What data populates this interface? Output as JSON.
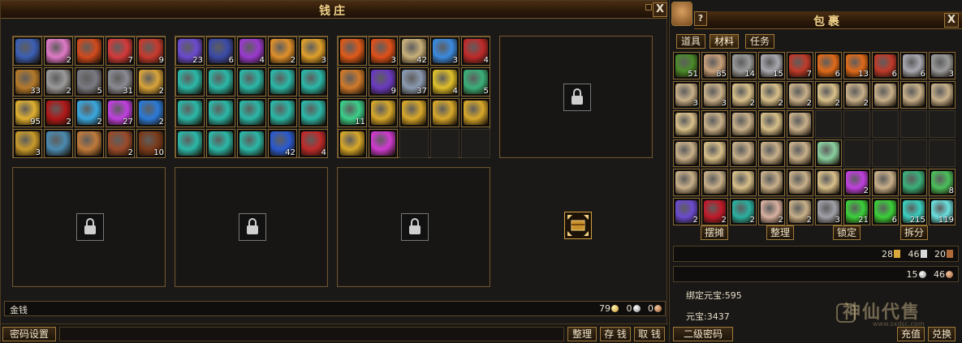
{
  "bank": {
    "title": "钱庄",
    "close_label": "X",
    "money_label": "金钱",
    "money": {
      "gold": "79",
      "silver": "0",
      "copper": "0"
    },
    "buttons": {
      "password": "密码设置",
      "organize": "整理",
      "deposit": "存 钱",
      "withdraw": "取 钱"
    },
    "bank_grids": [
      {
        "slots": [
          {
            "icon": "dragon-scroll-icon",
            "color": "#3b5fb5",
            "count": ""
          },
          {
            "icon": "pink-crystal-icon",
            "color": "#e07ac8",
            "count": "2"
          },
          {
            "icon": "flame-gem-icon",
            "color": "#d24a1c",
            "count": ""
          },
          {
            "icon": "red-pearl-icon",
            "color": "#d43a3a",
            "count": "7"
          },
          {
            "icon": "red-ring-icon",
            "color": "#c93a2e",
            "count": "9"
          },
          {
            "icon": "bronze-claw-icon",
            "color": "#b57a2a",
            "count": "33"
          },
          {
            "icon": "ore-icon",
            "color": "#9a9a9a",
            "count": "2"
          },
          {
            "icon": "iron-ore-icon",
            "color": "#7a7a82",
            "count": "5"
          },
          {
            "icon": "silver-ore-icon",
            "color": "#8a8a92",
            "count": "31"
          },
          {
            "icon": "gold-ingot-icon",
            "color": "#d9a43a",
            "count": "2"
          },
          {
            "icon": "gold-lump-icon",
            "color": "#e0b030",
            "count": "95"
          },
          {
            "icon": "blood-orb-icon",
            "color": "#b01818",
            "count": "2"
          },
          {
            "icon": "ice-crystal-icon",
            "color": "#3aa8e0",
            "count": "2"
          },
          {
            "icon": "violet-orb-icon",
            "color": "#c040e0",
            "count": "27"
          },
          {
            "icon": "blue-blade-icon",
            "color": "#2a7ad8",
            "count": "2"
          },
          {
            "icon": "gold-pile-icon",
            "color": "#c89a2a",
            "count": "3"
          },
          {
            "icon": "treasure-chest-icon",
            "color": "#4a8ab0",
            "count": ""
          },
          {
            "icon": "gift-box-icon",
            "color": "#c07a3a",
            "count": ""
          },
          {
            "icon": "red-box-icon",
            "color": "#9a4a2a",
            "count": "2"
          },
          {
            "icon": "gear-bag-icon",
            "color": "#7a3a1a",
            "count": "10"
          }
        ]
      },
      {
        "slots": [
          {
            "icon": "swirl-orb-icon",
            "color": "#6a4ad0",
            "count": "23"
          },
          {
            "icon": "lightning-scroll-icon",
            "color": "#3a4aa8",
            "count": "6"
          },
          {
            "icon": "purple-flame-icon",
            "color": "#9a3ad0",
            "count": "4"
          },
          {
            "icon": "feather-icon",
            "color": "#e0902a",
            "count": "2"
          },
          {
            "icon": "fire-feather-icon",
            "color": "#e0a02a",
            "count": "3"
          },
          {
            "icon": "teal-potion-icon",
            "color": "#2ab8a8",
            "count": ""
          },
          {
            "icon": "teal-potion-icon",
            "color": "#2ab8a8",
            "count": ""
          },
          {
            "icon": "teal-potion-icon",
            "color": "#2ab8a8",
            "count": ""
          },
          {
            "icon": "teal-potion-icon",
            "color": "#2ab8a8",
            "count": ""
          },
          {
            "icon": "teal-potion-icon",
            "color": "#2ab8a8",
            "count": ""
          },
          {
            "icon": "teal-potion-icon",
            "color": "#2ab8a8",
            "count": ""
          },
          {
            "icon": "teal-potion-icon",
            "color": "#2ab8a8",
            "count": ""
          },
          {
            "icon": "teal-potion-icon",
            "color": "#2ab8a8",
            "count": ""
          },
          {
            "icon": "teal-potion-icon",
            "color": "#2ab8a8",
            "count": ""
          },
          {
            "icon": "teal-potion-icon",
            "color": "#2ab8a8",
            "count": ""
          },
          {
            "icon": "teal-potion-icon",
            "color": "#2ab8a8",
            "count": ""
          },
          {
            "icon": "teal-potion-icon",
            "color": "#2ab8a8",
            "count": ""
          },
          {
            "icon": "teal-potion-icon",
            "color": "#2ab8a8",
            "count": ""
          },
          {
            "icon": "blue-rune-icon",
            "color": "#2a5ad0",
            "count": "42"
          },
          {
            "icon": "red-orb-icon",
            "color": "#c02a2a",
            "count": "4"
          }
        ]
      },
      {
        "slots": [
          {
            "icon": "flame-claw-icon",
            "color": "#e05a1a",
            "count": ""
          },
          {
            "icon": "fire-scroll-icon",
            "color": "#e0501a",
            "count": "3"
          },
          {
            "icon": "parchment-icon",
            "color": "#c8b07a",
            "count": "42"
          },
          {
            "icon": "ice-dragon-icon",
            "color": "#3a8ae0",
            "count": "3"
          },
          {
            "icon": "demon-mask-icon",
            "color": "#c02a2a",
            "count": "4"
          },
          {
            "icon": "amber-orb-icon",
            "color": "#d07a2a",
            "count": ""
          },
          {
            "icon": "galaxy-orb-icon",
            "color": "#6a3ac0",
            "count": "9"
          },
          {
            "icon": "map-icon",
            "color": "#8a9ab0",
            "count": "37"
          },
          {
            "icon": "sun-emblem-icon",
            "color": "#e0c02a",
            "count": "4"
          },
          {
            "icon": "jade-vase-icon",
            "color": "#3ab07a",
            "count": "5"
          },
          {
            "icon": "jade-disc-icon",
            "color": "#3ad08a",
            "count": "11"
          },
          {
            "icon": "golden-spear-icon",
            "color": "#d8a82a",
            "count": ""
          },
          {
            "icon": "golden-spear-icon",
            "color": "#d8a82a",
            "count": ""
          },
          {
            "icon": "golden-spear-icon",
            "color": "#d8a82a",
            "count": ""
          },
          {
            "icon": "golden-spear-icon",
            "color": "#d8a82a",
            "count": ""
          },
          {
            "icon": "golden-spear-icon",
            "color": "#d8a82a",
            "count": ""
          },
          {
            "icon": "magenta-crystal-icon",
            "color": "#d03ad0",
            "count": ""
          },
          {
            "icon": "",
            "color": "",
            "count": ""
          },
          {
            "icon": "",
            "color": "",
            "count": ""
          },
          {
            "icon": "",
            "color": "",
            "count": ""
          }
        ]
      }
    ],
    "transfer_icon": "exchange-chest-icon"
  },
  "inventory": {
    "title": "包裹",
    "help_label": "?",
    "close_label": "X",
    "tabs": [
      "道具",
      "材料",
      "任务"
    ],
    "active_tab": 1,
    "slots": [
      {
        "icon": "herb-icon",
        "color": "#4a8a2a",
        "count": "51"
      },
      {
        "icon": "parchment-icon",
        "color": "#c8a07a",
        "count": "85"
      },
      {
        "icon": "iron-ore-icon",
        "color": "#9a9a9a",
        "count": "14"
      },
      {
        "icon": "silver-ore-icon",
        "color": "#a8a8b0",
        "count": "15"
      },
      {
        "icon": "red-ore-icon",
        "color": "#c03a2a",
        "count": "7"
      },
      {
        "icon": "flame-claw-icon",
        "color": "#e06a1a",
        "count": "6"
      },
      {
        "icon": "flame-claw-icon",
        "color": "#e06a1a",
        "count": "13"
      },
      {
        "icon": "red-ore-icon",
        "color": "#c03a2a",
        "count": "6"
      },
      {
        "icon": "silver-ore-icon",
        "color": "#a8a8b0",
        "count": "6"
      },
      {
        "icon": "iron-ore-icon",
        "color": "#9a9a9a",
        "count": "3"
      },
      {
        "icon": "book-icon",
        "color": "#c8b08a",
        "count": "3"
      },
      {
        "icon": "book-icon",
        "color": "#c8b08a",
        "count": "3"
      },
      {
        "icon": "book-icon",
        "color": "#d8c08a",
        "count": "2"
      },
      {
        "icon": "book-icon",
        "color": "#d8c08a",
        "count": "2"
      },
      {
        "icon": "book-icon",
        "color": "#c8b08a",
        "count": "2"
      },
      {
        "icon": "book-icon",
        "color": "#d8c08a",
        "count": "2"
      },
      {
        "icon": "book-icon",
        "color": "#c8b08a",
        "count": "2"
      },
      {
        "icon": "book-icon",
        "color": "#c8b08a",
        "count": ""
      },
      {
        "icon": "book-icon",
        "color": "#c8b08a",
        "count": ""
      },
      {
        "icon": "book-icon",
        "color": "#c8b08a",
        "count": ""
      },
      {
        "icon": "book-icon",
        "color": "#d8c08a",
        "count": ""
      },
      {
        "icon": "book-icon",
        "color": "#c8b08a",
        "count": ""
      },
      {
        "icon": "book-icon",
        "color": "#c8b08a",
        "count": ""
      },
      {
        "icon": "book-icon",
        "color": "#d8c08a",
        "count": ""
      },
      {
        "icon": "book-icon",
        "color": "#c8b08a",
        "count": ""
      },
      {
        "icon": "",
        "color": "",
        "count": ""
      },
      {
        "icon": "",
        "color": "",
        "count": ""
      },
      {
        "icon": "",
        "color": "",
        "count": ""
      },
      {
        "icon": "",
        "color": "",
        "count": ""
      },
      {
        "icon": "",
        "color": "",
        "count": ""
      },
      {
        "icon": "book-icon",
        "color": "#c8b08a",
        "count": ""
      },
      {
        "icon": "book-icon",
        "color": "#d8c08a",
        "count": ""
      },
      {
        "icon": "book-icon",
        "color": "#c8b08a",
        "count": ""
      },
      {
        "icon": "book-icon",
        "color": "#c8b08a",
        "count": ""
      },
      {
        "icon": "book-icon",
        "color": "#c8b08a",
        "count": ""
      },
      {
        "icon": "jade-pendant-icon",
        "color": "#8ad0a0",
        "count": ""
      },
      {
        "icon": "",
        "color": "",
        "count": ""
      },
      {
        "icon": "",
        "color": "",
        "count": ""
      },
      {
        "icon": "",
        "color": "",
        "count": ""
      },
      {
        "icon": "",
        "color": "",
        "count": ""
      },
      {
        "icon": "book-icon",
        "color": "#c8b08a",
        "count": ""
      },
      {
        "icon": "book-icon",
        "color": "#c8b08a",
        "count": ""
      },
      {
        "icon": "book-icon",
        "color": "#d8c08a",
        "count": ""
      },
      {
        "icon": "book-icon",
        "color": "#c8b08a",
        "count": ""
      },
      {
        "icon": "book-icon",
        "color": "#c8b08a",
        "count": ""
      },
      {
        "icon": "book-icon",
        "color": "#d8c08a",
        "count": ""
      },
      {
        "icon": "violet-orb-icon",
        "color": "#c040e0",
        "count": "2"
      },
      {
        "icon": "book-icon",
        "color": "#c8b08a",
        "count": ""
      },
      {
        "icon": "jade-vase-icon",
        "color": "#3ab07a",
        "count": ""
      },
      {
        "icon": "green-crystal-icon",
        "color": "#4ac05a",
        "count": "8"
      },
      {
        "icon": "swirl-orb-icon",
        "color": "#6a4ad0",
        "count": "2"
      },
      {
        "icon": "red-gem-icon",
        "color": "#c01a2a",
        "count": "2"
      },
      {
        "icon": "teal-gem-icon",
        "color": "#2ab0a0",
        "count": "2"
      },
      {
        "icon": "parchment-icon",
        "color": "#d8b0a0",
        "count": "2"
      },
      {
        "icon": "book-icon",
        "color": "#c8b08a",
        "count": "2"
      },
      {
        "icon": "silver-ore-icon",
        "color": "#a0a0a8",
        "count": "3"
      },
      {
        "icon": "green-orb-icon",
        "color": "#3ad03a",
        "count": "21"
      },
      {
        "icon": "green-orb-icon",
        "color": "#3ad03a",
        "count": "6"
      },
      {
        "icon": "cyan-orb-icon",
        "color": "#3ad0c0",
        "count": "215"
      },
      {
        "icon": "cyan-orb-icon",
        "color": "#6ae0e0",
        "count": "119"
      }
    ],
    "actions": [
      "摆摊",
      "整理",
      "锁定",
      "拆分"
    ],
    "stack_row_1": {
      "a": "28",
      "b": "46",
      "c": "20"
    },
    "stack_row_2": {
      "a": "15",
      "b": "46"
    },
    "bound_ingot_label": "绑定元宝:",
    "bound_ingot_value": "595",
    "ingot_label": "元宝:",
    "ingot_value": "3437",
    "secondary_password": "二级密码",
    "recharge": "充值",
    "exchange": "兑换"
  },
  "watermark": {
    "text": "神仙代售",
    "sub": "www.sxdsc.com"
  },
  "colors": {
    "frame_gold": "#a07a3a",
    "title_text": "#f2d38a"
  }
}
